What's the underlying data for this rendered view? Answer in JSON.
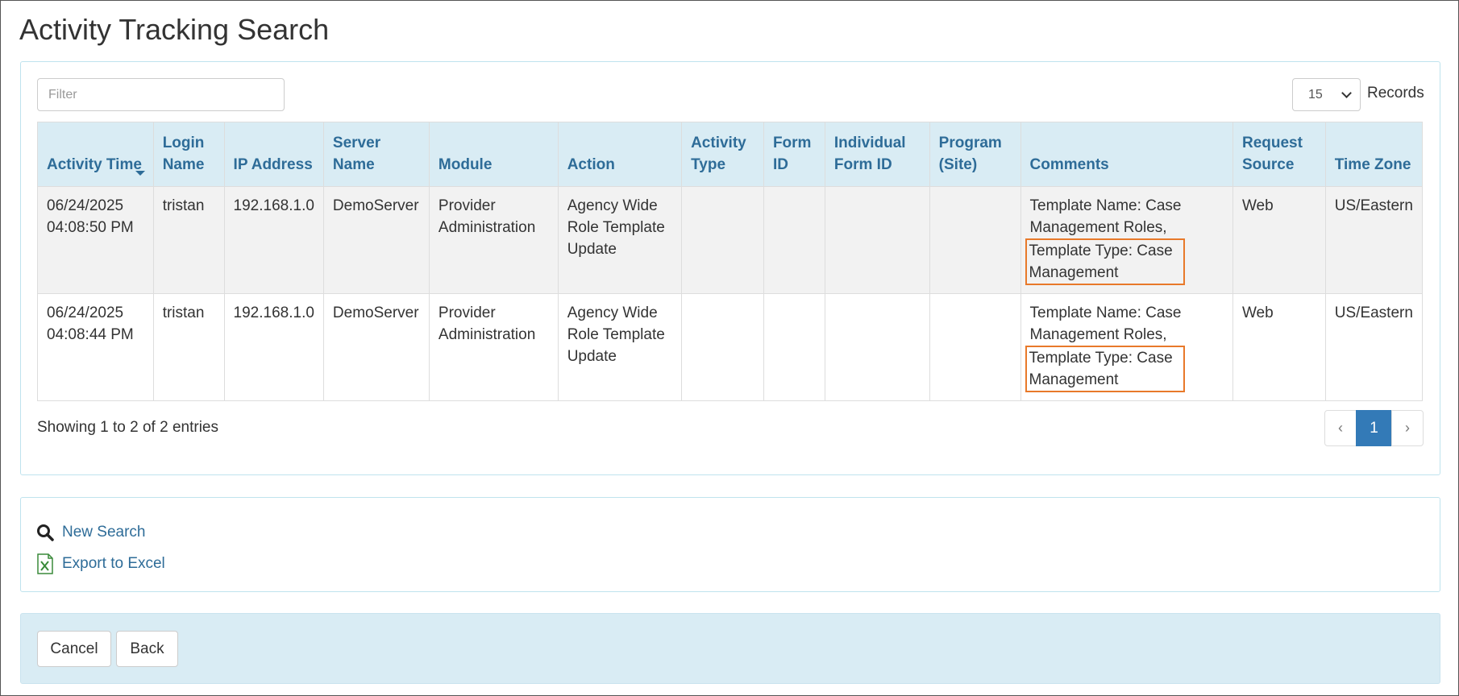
{
  "page": {
    "title": "Activity Tracking Search"
  },
  "search": {
    "filter_placeholder": "Filter",
    "filter_value": "",
    "page_size": "15",
    "records_label": "Records"
  },
  "table": {
    "headers": [
      [
        "Activity Time"
      ],
      [
        "Login",
        "Name"
      ],
      [
        "IP Address"
      ],
      [
        "Server",
        "Name"
      ],
      [
        "Module"
      ],
      [
        "Action"
      ],
      [
        "Activity",
        "Type"
      ],
      [
        "Form",
        "ID"
      ],
      [
        "Individual",
        "Form ID"
      ],
      [
        "Program",
        "(Site)"
      ],
      [
        "Comments"
      ],
      [
        "Request",
        "Source"
      ],
      [
        "Time Zone"
      ]
    ],
    "rows": [
      {
        "activity_time": [
          "06/24/2025",
          "04:08:50 PM"
        ],
        "login_name": "tristan",
        "ip_address": "192.168.1.0",
        "server_name": "DemoServer",
        "module": [
          "Provider",
          "Administration"
        ],
        "action": [
          "Agency Wide",
          "Role Template",
          "Update"
        ],
        "activity_type": "",
        "form_id": "",
        "individual_form_id": "",
        "program_site": "",
        "comments": [
          "Template Name: Case",
          "Management Roles,"
        ],
        "comments_highlighted": [
          "Template Type: Case",
          "Management"
        ],
        "request_source": "Web",
        "time_zone": "US/Eastern"
      },
      {
        "activity_time": [
          "06/24/2025",
          "04:08:44 PM"
        ],
        "login_name": "tristan",
        "ip_address": "192.168.1.0",
        "server_name": "DemoServer",
        "module": [
          "Provider",
          "Administration"
        ],
        "action": [
          "Agency Wide",
          "Role Template",
          "Update"
        ],
        "activity_type": "",
        "form_id": "",
        "individual_form_id": "",
        "program_site": "",
        "comments": [
          "Template Name: Case",
          "Management Roles,"
        ],
        "comments_highlighted": [
          "Template Type: Case",
          "Management"
        ],
        "request_source": "Web",
        "time_zone": "US/Eastern"
      }
    ]
  },
  "pagination": {
    "summary": "Showing 1 to 2 of 2 entries",
    "prev": "‹",
    "current": "1",
    "next": "›"
  },
  "actions": {
    "new_search": {
      "label": "New Search",
      "icon": "search-icon"
    },
    "export": {
      "label": "Export to Excel",
      "icon": "excel-icon"
    }
  },
  "footer": {
    "cancel": "Cancel",
    "back": "Back"
  },
  "colors": {
    "header_text": "#2e6c98",
    "header_bg": "#d9ecf4",
    "highlight_border": "#e8792a",
    "active_page": "#337ab7"
  }
}
